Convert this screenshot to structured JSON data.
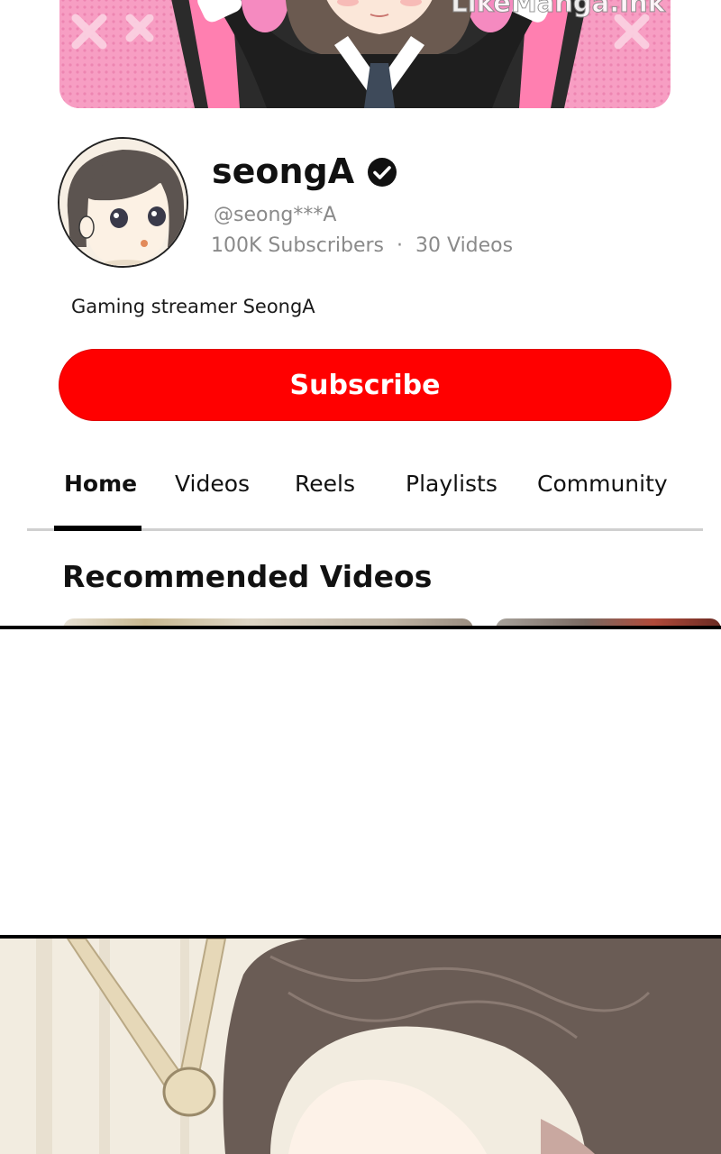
{
  "watermark": "LikeManga.Ink",
  "channel": {
    "name": "seongA",
    "handle": "@seong***A",
    "subscribers": "100K Subscribers",
    "separator": "·",
    "videos": "30 Videos",
    "description": "Gaming streamer SeongA",
    "verified_icon": "verified-check-icon"
  },
  "actions": {
    "subscribe_label": "Subscribe"
  },
  "tabs": [
    {
      "label": "Home",
      "active": true
    },
    {
      "label": "Videos",
      "active": false
    },
    {
      "label": "Reels",
      "active": false
    },
    {
      "label": "Playlists",
      "active": false
    },
    {
      "label": "Community",
      "active": false
    }
  ],
  "sections": {
    "recommended_title": "Recommended Videos"
  },
  "colors": {
    "subscribe": "#ff0000",
    "banner": "#f79ec3"
  }
}
